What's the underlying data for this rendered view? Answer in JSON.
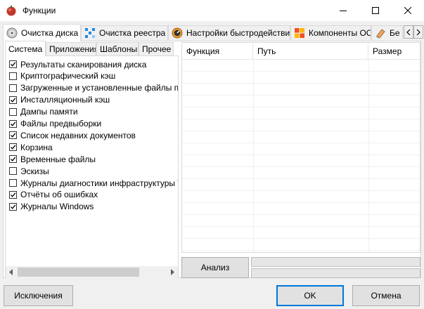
{
  "window": {
    "title": "Функции"
  },
  "main_tabs": [
    {
      "label": "Очистка диска",
      "active": true
    },
    {
      "label": "Очистка реестра",
      "active": false
    },
    {
      "label": "Настройки быстродействия",
      "active": false
    },
    {
      "label": "Компоненты ОС",
      "active": false
    },
    {
      "label": "Бе",
      "active": false
    }
  ],
  "sub_tabs": [
    {
      "label": "Система",
      "active": true
    },
    {
      "label": "Приложения",
      "active": false
    },
    {
      "label": "Шаблоны",
      "active": false
    },
    {
      "label": "Прочее",
      "active": false
    }
  ],
  "items": [
    {
      "label": "Результаты сканирования диска",
      "checked": true
    },
    {
      "label": "Криптографический кэш",
      "checked": false
    },
    {
      "label": "Загруженные и установленные файлы прог",
      "checked": false
    },
    {
      "label": "Инсталляционный кэш",
      "checked": true
    },
    {
      "label": "Дампы памяти",
      "checked": false
    },
    {
      "label": "Файлы предвыборки",
      "checked": true
    },
    {
      "label": "Список недавних документов",
      "checked": true
    },
    {
      "label": "Корзина",
      "checked": true
    },
    {
      "label": "Временные файлы",
      "checked": true
    },
    {
      "label": "Эскизы",
      "checked": false
    },
    {
      "label": "Журналы диагностики инфраструктуры Wi",
      "checked": false
    },
    {
      "label": "Отчёты об ошибках",
      "checked": true
    },
    {
      "label": "Журналы Windows",
      "checked": true
    }
  ],
  "table": {
    "columns": [
      "Функция",
      "Путь",
      "Размер"
    ]
  },
  "buttons": {
    "analyze": "Анализ",
    "exclusions": "Исключения",
    "ok": "OK",
    "cancel": "Отмена"
  },
  "colors": {
    "accent": "#0078d7",
    "check": "#000000",
    "app_icon": "#c0392b"
  }
}
